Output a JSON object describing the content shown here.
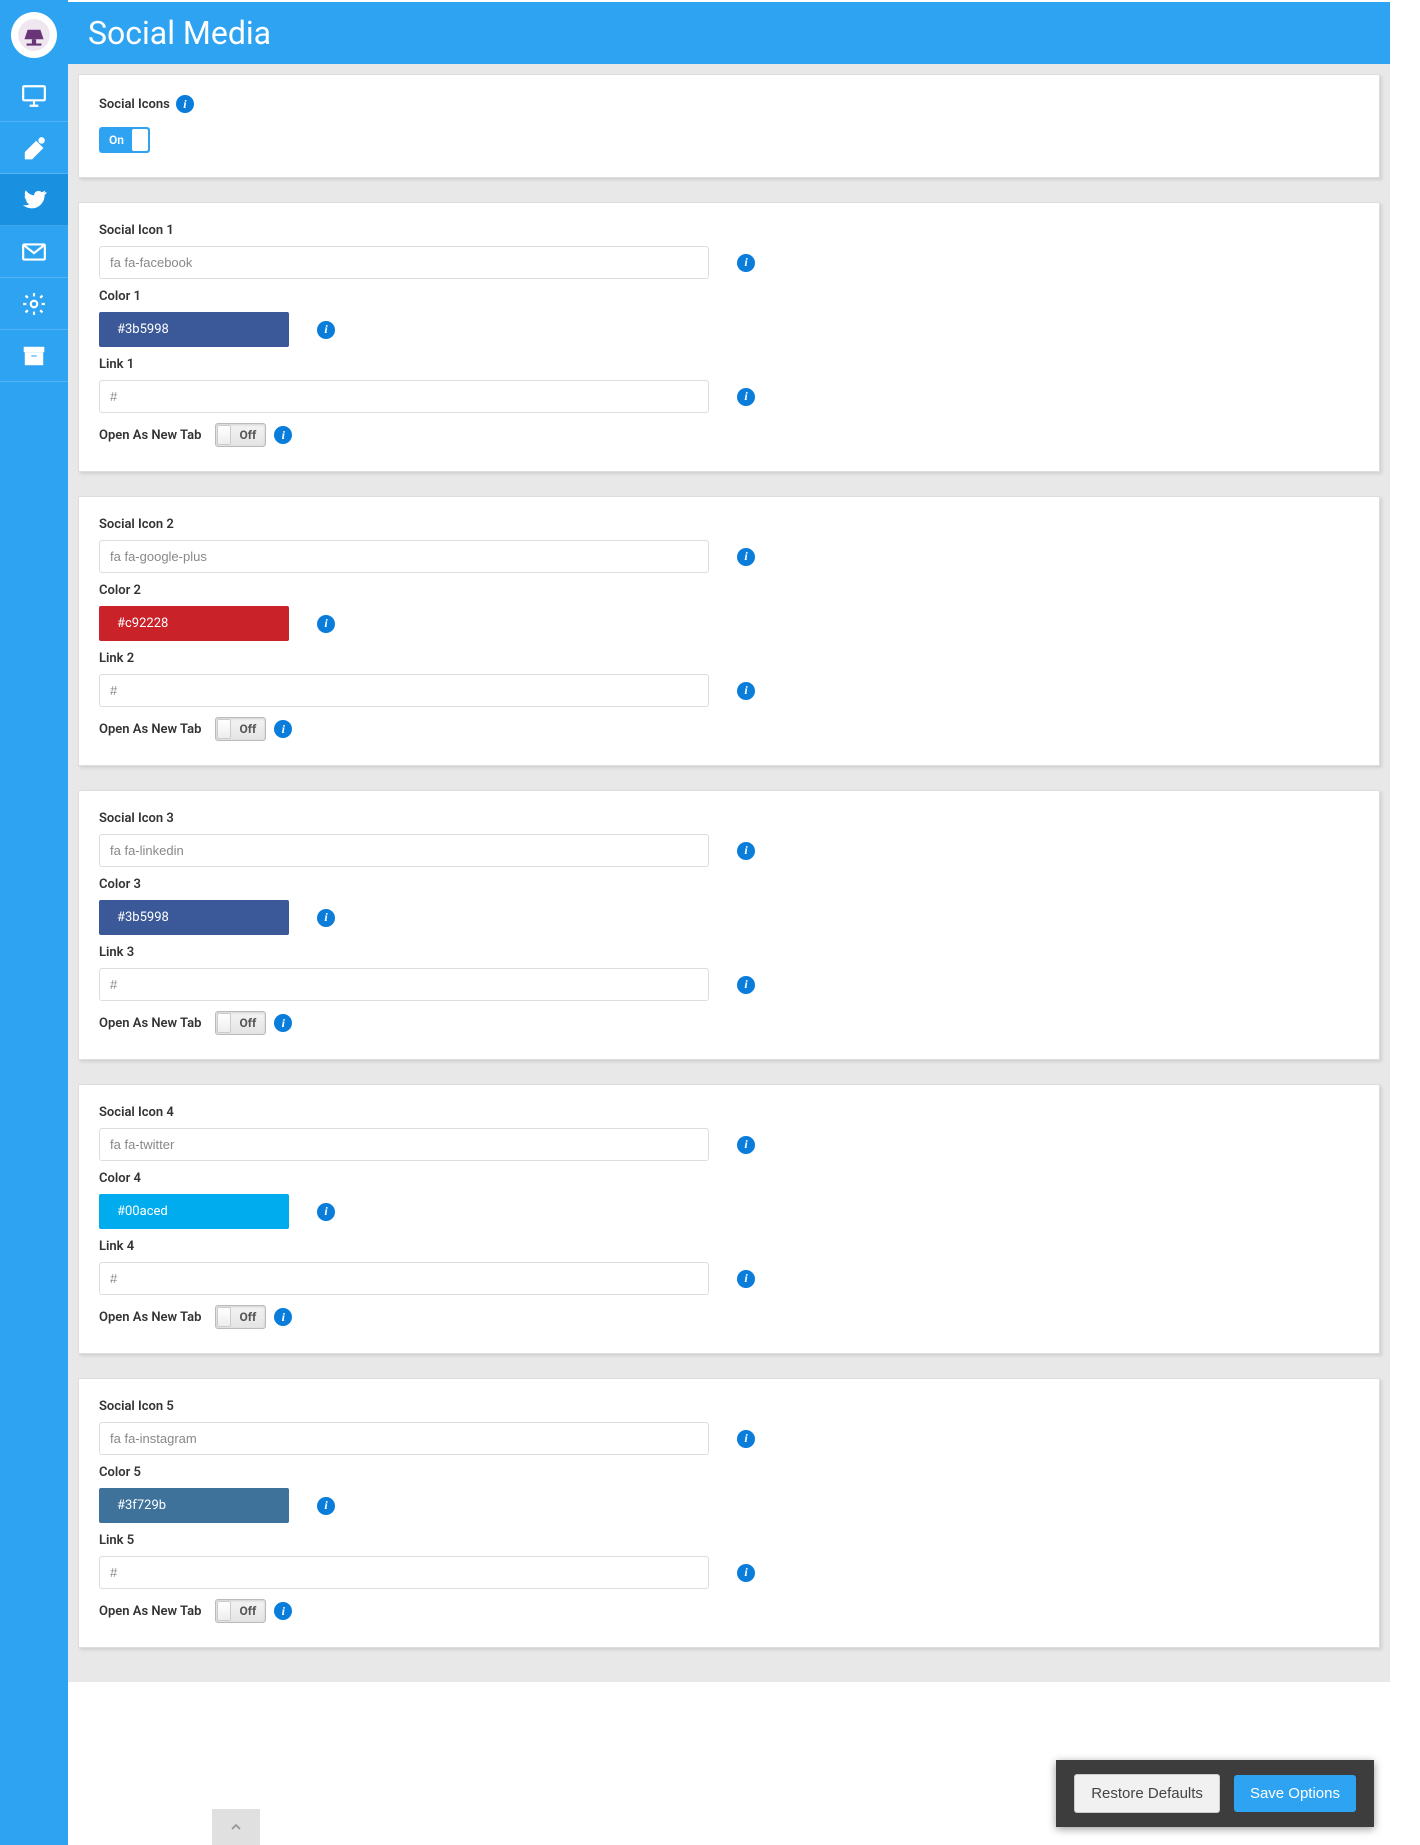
{
  "page_title": "Social Media",
  "toggle_on_label": "On",
  "toggle_off_label": "Off",
  "global": {
    "icons_label": "Social Icons",
    "enabled": true
  },
  "icons": [
    {
      "icon_label": "Social Icon 1",
      "icon_value": "fa fa-facebook",
      "color_label": "Color 1",
      "color_value": "#3b5998",
      "link_label": "Link 1",
      "link_value": "#",
      "newtab_label": "Open As New Tab"
    },
    {
      "icon_label": "Social Icon 2",
      "icon_value": "fa fa-google-plus",
      "color_label": "Color 2",
      "color_value": "#c92228",
      "link_label": "Link 2",
      "link_value": "#",
      "newtab_label": "Open As New Tab"
    },
    {
      "icon_label": "Social Icon 3",
      "icon_value": "fa fa-linkedin",
      "color_label": "Color 3",
      "color_value": "#3b5998",
      "link_label": "Link 3",
      "link_value": "#",
      "newtab_label": "Open As New Tab"
    },
    {
      "icon_label": "Social Icon 4",
      "icon_value": "fa fa-twitter",
      "color_label": "Color 4",
      "color_value": "#00aced",
      "link_label": "Link 4",
      "link_value": "#",
      "newtab_label": "Open As New Tab"
    },
    {
      "icon_label": "Social Icon 5",
      "icon_value": "fa fa-instagram",
      "color_label": "Color 5",
      "color_value": "#3f729b",
      "link_label": "Link 5",
      "link_value": "#",
      "newtab_label": "Open As New Tab"
    }
  ],
  "footer": {
    "restore": "Restore Defaults",
    "save": "Save Options"
  }
}
